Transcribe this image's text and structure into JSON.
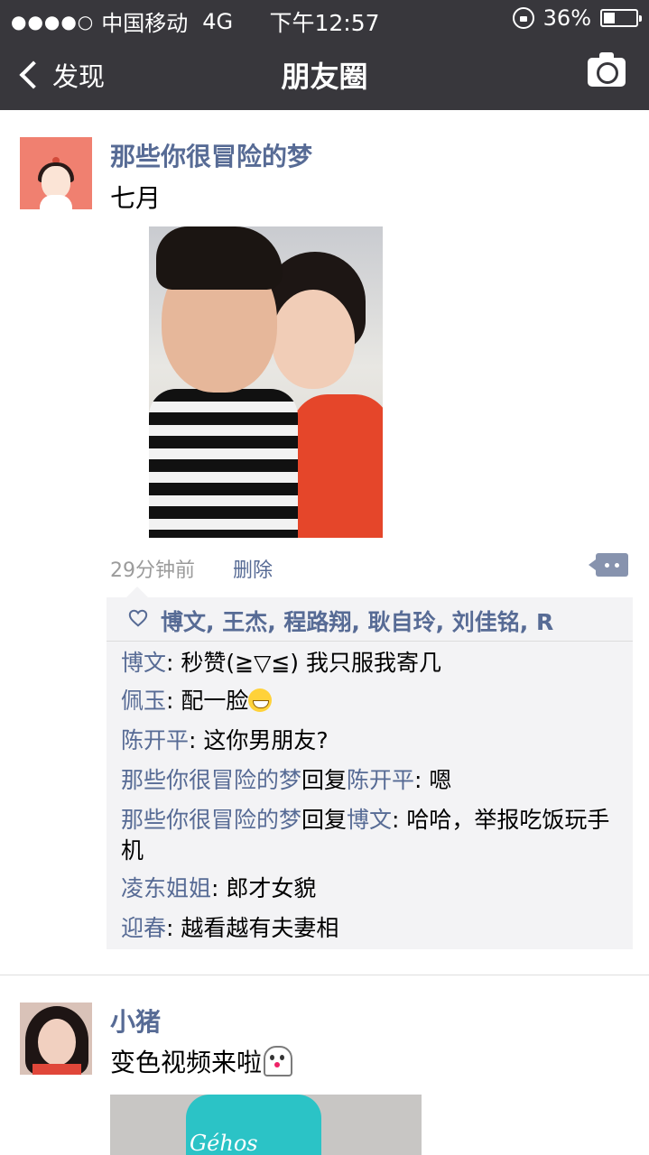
{
  "status_bar": {
    "signal_dots": "●●●●○",
    "carrier": "中国移动",
    "network": "4G",
    "time": "下午12:57",
    "battery_percent": "36%",
    "battery_level": 0.36
  },
  "nav": {
    "back_label": "发现",
    "title": "朋友圈",
    "camera_icon": "camera-icon"
  },
  "post1": {
    "author": "那些你很冒险的梦",
    "text": "七月",
    "time_ago": "29分钟前",
    "delete_label": "删除",
    "likes": "博文, 王杰, 程路翔, 耿自玲, 刘佳铭, R",
    "comments": [
      {
        "who": "博文",
        "sep": ": ",
        "text": "秒赞(≧▽≦) 我只服我寄几"
      },
      {
        "who": "佩玉",
        "sep": ": ",
        "text": "配一脸"
      },
      {
        "who": "陈开平",
        "sep": ": ",
        "text": "这你男朋友?"
      },
      {
        "who": "那些你很冒险的梦",
        "reply_word": "回复",
        "to": "陈开平",
        "sep": ": ",
        "text": "嗯"
      },
      {
        "who": "那些你很冒险的梦",
        "reply_word": "回复",
        "to": "博文",
        "sep": ": ",
        "text": "哈哈，举报吃饭玩手机"
      },
      {
        "who": "凌东姐姐",
        "sep": ": ",
        "text": "郎才女貌"
      },
      {
        "who": "迎春",
        "sep": ": ",
        "text": "越看越有夫妻相"
      }
    ]
  },
  "post2": {
    "author": "小猪",
    "text": "变色视频来啦",
    "photo_brand": "Géhos"
  },
  "colors": {
    "bar": "#38373c",
    "link": "#576b95",
    "comment_bg": "#f3f3f5"
  }
}
